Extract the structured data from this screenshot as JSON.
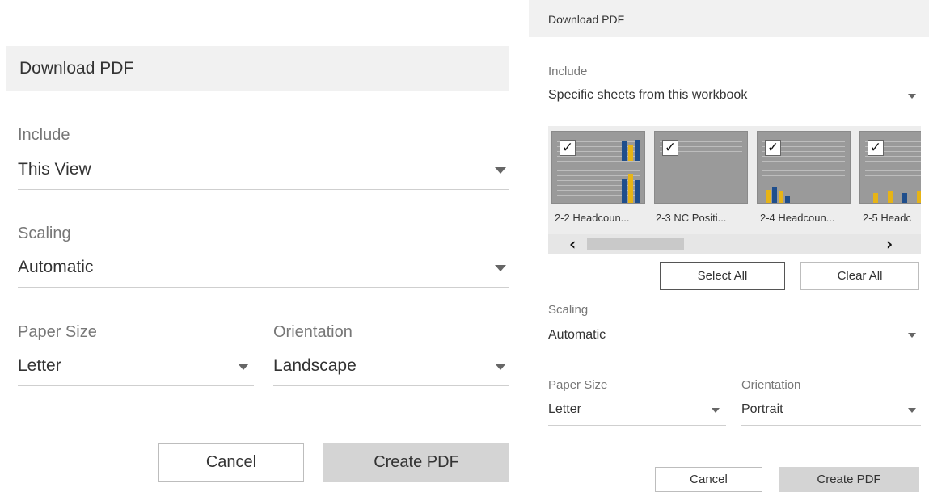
{
  "left_dialog": {
    "title": "Download PDF",
    "include": {
      "label": "Include",
      "value": "This View"
    },
    "scaling": {
      "label": "Scaling",
      "value": "Automatic"
    },
    "paper_size": {
      "label": "Paper Size",
      "value": "Letter"
    },
    "orientation": {
      "label": "Orientation",
      "value": "Landscape"
    },
    "cancel_label": "Cancel",
    "create_label": "Create PDF"
  },
  "right_dialog": {
    "title": "Download PDF",
    "include": {
      "label": "Include",
      "value": "Specific sheets from this workbook"
    },
    "sheets": [
      {
        "label": "2-2 Headcoun...",
        "checked": true
      },
      {
        "label": "2-3 NC Positi...",
        "checked": true
      },
      {
        "label": "2-4 Headcoun...",
        "checked": true
      },
      {
        "label": "2-5 Headc",
        "checked": true
      }
    ],
    "check_glyph": "✓",
    "scroll_left": "‹",
    "scroll_right": "›",
    "select_all_label": "Select All",
    "clear_all_label": "Clear All",
    "scaling": {
      "label": "Scaling",
      "value": "Automatic"
    },
    "paper_size": {
      "label": "Paper Size",
      "value": "Letter"
    },
    "orientation": {
      "label": "Orientation",
      "value": "Portrait"
    },
    "cancel_label": "Cancel",
    "create_label": "Create PDF"
  },
  "colors": {
    "bar_blue": "#1f4e8c",
    "bar_gold": "#e7b416",
    "header_bg": "#f1f1f1",
    "button_disabled_bg": "#d4d4d4"
  },
  "icons": {
    "dropdown": "caret-down-icon",
    "checkbox": "checkmark-icon",
    "scroll": "chevron-icon"
  }
}
